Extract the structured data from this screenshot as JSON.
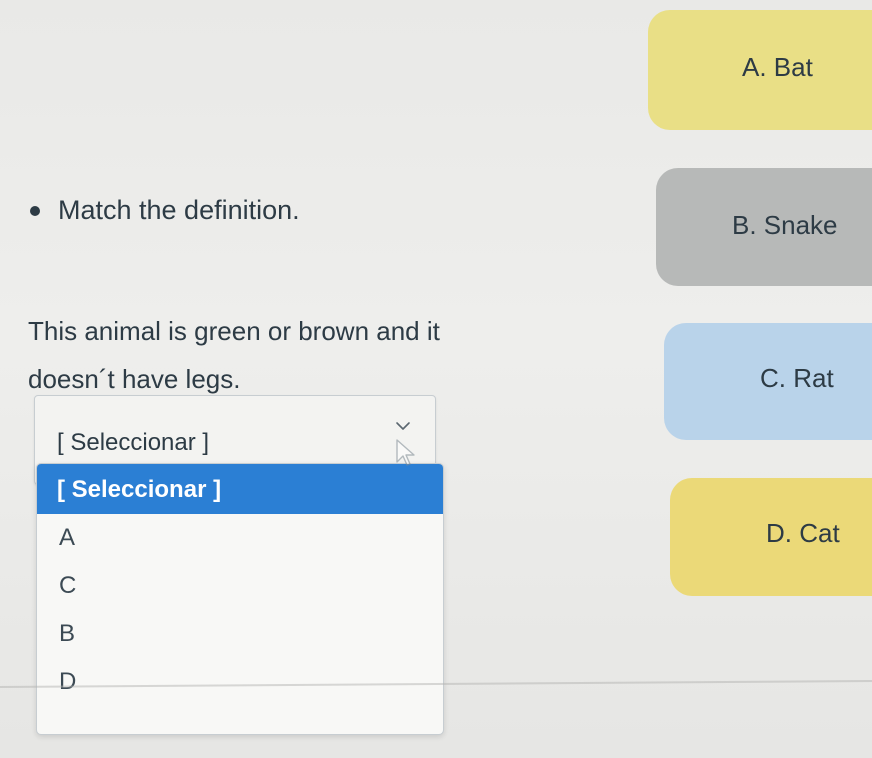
{
  "question": {
    "instruction": "Match the deﬁnition.",
    "prompt": "This animal is green or brown and it doesn´t have legs."
  },
  "select": {
    "current_value": "[ Seleccionar ]",
    "options": [
      "[ Seleccionar ]",
      "A",
      "C",
      "B",
      "D"
    ],
    "highlighted_index": 0
  },
  "answers": [
    {
      "label": "A. Bat",
      "color": "#e9df86"
    },
    {
      "label": "B. Snake",
      "color": "#b7b9b8"
    },
    {
      "label": "C. Rat",
      "color": "#b9d3ea"
    },
    {
      "label": "D. Cat",
      "color": "#ebd978"
    }
  ],
  "colors": {
    "accent": "#2b7fd4",
    "text": "#2d3b45"
  },
  "icons": {
    "chevron": "chevron-down-icon",
    "cursor": "mouse-pointer-icon",
    "bullet": "bullet-icon"
  }
}
